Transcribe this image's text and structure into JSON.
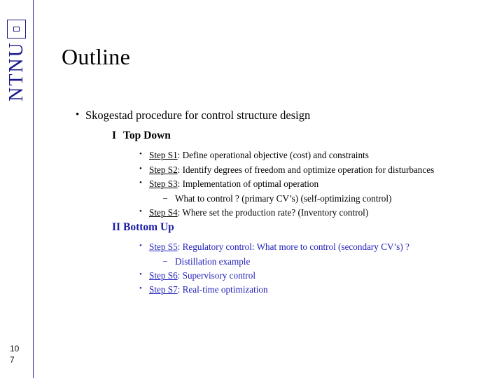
{
  "logo": {
    "text": "NTNU",
    "icon": "ntnu-monogram-icon"
  },
  "footer": {
    "line1": "10",
    "line2": "7"
  },
  "slide": {
    "title": "Outline",
    "bullet_glyph": "•",
    "dash_glyph": "–",
    "items": {
      "main": "Skogestad procedure for control structure design",
      "section1_roman": "I",
      "section1_label": "Top Down",
      "step1_name": "Step S1",
      "step1_text": ": Define operational objective (cost) and constraints",
      "step2_name": "Step S2",
      "step2_text": ": Identify degrees of freedom and optimize operation for disturbances",
      "step3_name": "Step S3",
      "step3_text": ": Implementation of optimal operation",
      "step3_sub": "What to control ? (primary CV’s) (self-optimizing control)",
      "step4_name": "Step S4",
      "step4_text": ": Where set the production rate? (Inventory control)",
      "section2_roman": "II",
      "section2_label": "Bottom Up",
      "step5_name": "Step S5",
      "step5_text": ": Regulatory control: What more to control (secondary CV’s) ?",
      "step5_sub": "Distillation example",
      "step6_name": "Step S6",
      "step6_text": ": Supervisory control",
      "step7_name": "Step S7",
      "step7_text": ": Real-time optimization"
    }
  }
}
